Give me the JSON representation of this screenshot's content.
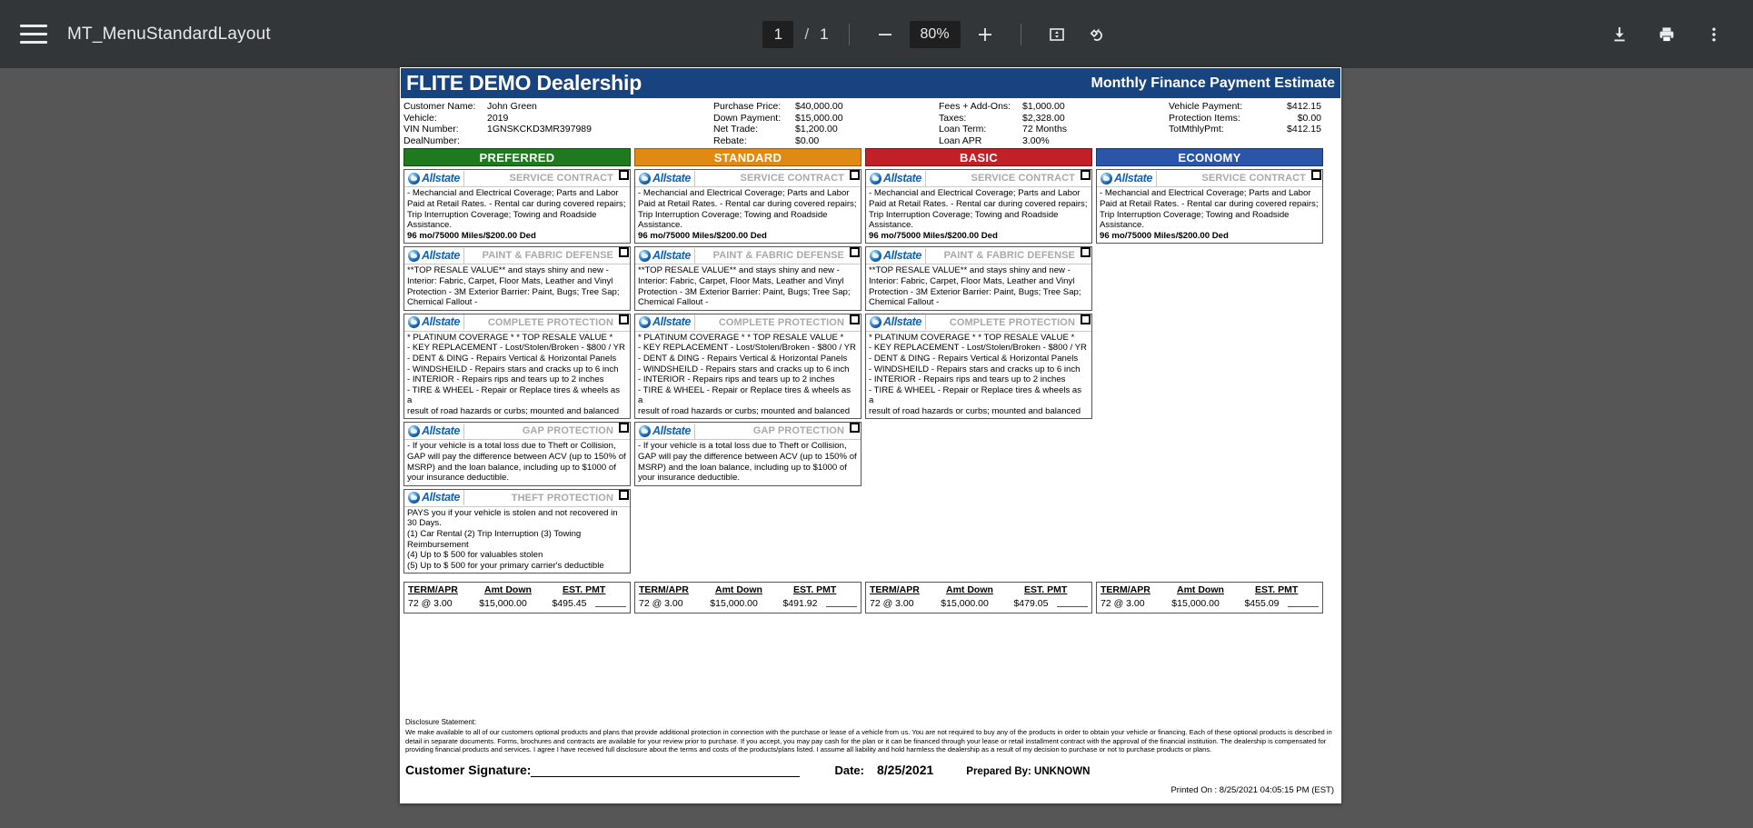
{
  "toolbar": {
    "menu_icon": "hamburger-menu-icon",
    "title": "MT_MenuStandardLayout",
    "page_current": "1",
    "page_separator": "/",
    "page_total": "1",
    "zoom_out_icon": "minus-icon",
    "zoom_level": "80%",
    "zoom_in_icon": "plus-icon",
    "fit_icon": "fit-to-page-icon",
    "rotate_icon": "rotate-icon",
    "download_icon": "download-icon",
    "print_icon": "print-icon",
    "more_icon": "more-vertical-icon"
  },
  "document": {
    "header": {
      "brand": "FLITE DEMO Dealership",
      "subtitle": "Monthly Finance Payment Estimate"
    },
    "info": {
      "col1": [
        {
          "label": "Customer Name:",
          "value": "John Green"
        },
        {
          "label": "Vehicle:",
          "value": "2019"
        },
        {
          "label": "VIN Number:",
          "value": "1GNSKCKD3MR397989"
        },
        {
          "label": "DealNumber:",
          "value": ""
        }
      ],
      "col2": [
        {
          "label": "Purchase Price:",
          "value": "$40,000.00"
        },
        {
          "label": "Down Payment:",
          "value": "$15,000.00"
        },
        {
          "label": "Net Trade:",
          "value": "$1,200.00"
        },
        {
          "label": "Rebate:",
          "value": "$0.00"
        }
      ],
      "col3": [
        {
          "label": "Fees + Add-Ons:",
          "value": "$1,000.00"
        },
        {
          "label": "Taxes:",
          "value": "$2,328.00"
        },
        {
          "label": "Loan Term:",
          "value": "72 Months"
        },
        {
          "label": "Loan APR",
          "value": "3.00%"
        }
      ],
      "col4": [
        {
          "label": "Vehicle Payment:",
          "value": "$412.15"
        },
        {
          "label": "Protection Items:",
          "value": "$0.00"
        },
        {
          "label": "TotMthlyPmt:",
          "value": "$412.15"
        }
      ]
    },
    "brand_logo_text": "Allstate",
    "products": {
      "service_contract": {
        "title": "SERVICE CONTRACT",
        "body": "- Mechancial and Electrical Coverage; Parts and Labor Paid at Retail Rates. - Rental car during covered repairs; Trip Interruption Coverage; Towing and Roadside Assistance.",
        "term": "96 mo/75000 Miles/$200.00 Ded"
      },
      "paint_fabric": {
        "title": "PAINT & FABRIC DEFENSE",
        "body": "**TOP RESALE VALUE** and stays shiny and new - Interior: Fabric, Carpet, Floor Mats, Leather and Vinyl Protection - 3M Exterior Barrier: Paint, Bugs; Tree Sap; Chemical Fallout -",
        "term": ""
      },
      "complete_protection": {
        "title": "COMPLETE PROTECTION",
        "body": "* PLATINUM COVERAGE * * TOP RESALE VALUE *\n- KEY REPLACEMENT - Lost/Stolen/Broken - $800 / YR\n- DENT & DING - Repairs Vertical & Horizontal Panels\n- WINDSHEILD - Repairs stars and cracks up to 6 inch\n- INTERIOR - Repairs rips and tears up to 2 inches\n- TIRE & WHEEL - Repair or Replace tires & wheels as a\n  result of road hazards or curbs; mounted and balanced",
        "term": ""
      },
      "gap_protection": {
        "title": "GAP PROTECTION",
        "body": "- If your vehicle is a total loss due to Theft or Collision, GAP will pay the difference between ACV (up to 150% of MSRP) and the loan balance, including up to $1000 of your insurance deductible.",
        "term": ""
      },
      "theft_protection": {
        "title": "THEFT PROTECTION",
        "body": "PAYS you if your vehicle is stolen and not recovered in 30 Days.\n(1)  Car Rental (2)  Trip Interruption (3)  Towing Reimbursement\n(4)  Up to $ 500 for valuables stolen\n(5)  Up to $ 500 for your primary carrier's deductible",
        "term": ""
      }
    },
    "plans": [
      {
        "name": "PREFERRED",
        "color": "#1f7a1f",
        "items": [
          "service_contract",
          "paint_fabric",
          "complete_protection",
          "gap_protection",
          "theft_protection"
        ],
        "terms": {
          "term_apr": "72 @ 3.00",
          "amt_down": "$15,000.00",
          "est_pmt": "$495.45"
        }
      },
      {
        "name": "STANDARD",
        "color": "#e08a14",
        "items": [
          "service_contract",
          "paint_fabric",
          "complete_protection",
          "gap_protection"
        ],
        "terms": {
          "term_apr": "72 @ 3.00",
          "amt_down": "$15,000.00",
          "est_pmt": "$491.92"
        }
      },
      {
        "name": "BASIC",
        "color": "#c12026",
        "items": [
          "service_contract",
          "paint_fabric",
          "complete_protection"
        ],
        "terms": {
          "term_apr": "72 @ 3.00",
          "amt_down": "$15,000.00",
          "est_pmt": "$479.05"
        }
      },
      {
        "name": "ECONOMY",
        "color": "#2a55a8",
        "items": [
          "service_contract"
        ],
        "terms": {
          "term_apr": "72 @ 3.00",
          "amt_down": "$15,000.00",
          "est_pmt": "$455.09"
        }
      }
    ],
    "terms_headers": {
      "term_apr": "TERM/APR",
      "amt_down": "Amt Down",
      "est_pmt": "EST. PMT"
    },
    "footer": {
      "disclosure_label": "Disclosure Statement:",
      "disclosure_text": "We make available to all of our customers optional products and plans that provide additional protection in connection with the purchase or lease of a vehicle from us.  You are not required to buy any of the products in order to obtain your vehicle or financing.  Each of these optional products is described in detail in separate documents. Forms, brochures and contracts are available for your review prior to purchase.  If you accept, you may pay cash for the plan or it can be financed through your lease or retail installment contract with the approval of the financial institution.  The dealership is compensated for providing financial products and services.  I agree I have received full disclosure about the terms and costs of the products/plans listed.  I assume all liability and hold harmless the dealership as a result of my decision to purchase or not to purchase products or plans.",
      "signature_label": "Customer Signature:",
      "date_label": "Date:",
      "date_value": "8/25/2021",
      "prepared_by": "Prepared By: UNKNOWN",
      "printed_on": "Printed On : 8/25/2021 04:05:15 PM (EST)"
    }
  }
}
